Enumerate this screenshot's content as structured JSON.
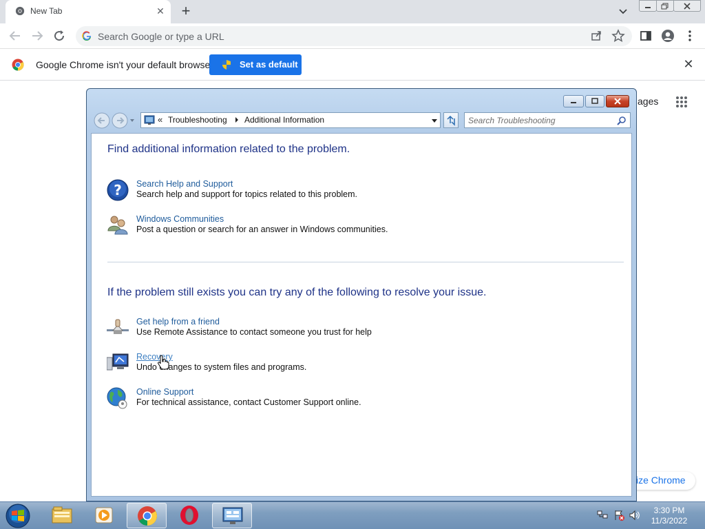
{
  "browser": {
    "tab": {
      "title": "New Tab",
      "close": "✕"
    },
    "new_tab_label": "+",
    "omnibox": {
      "placeholder": "Search Google or type a URL"
    },
    "infobar": {
      "message": "Google Chrome isn't your default browser",
      "button": "Set as default",
      "close": "✕"
    },
    "ntp": {
      "images_link_partial": "ages",
      "customize_partial": "ize Chrome"
    }
  },
  "explorer": {
    "breadcrumb": {
      "chev": "«",
      "items": [
        "Troubleshooting",
        "Additional Information"
      ]
    },
    "search": {
      "placeholder": "Search Troubleshooting"
    },
    "sections": [
      {
        "heading": "Find additional information related to the problem.",
        "items": [
          {
            "icon": "help-icon",
            "title": "Search Help and Support",
            "desc": "Search help and support for topics related to this problem."
          },
          {
            "icon": "people-icon",
            "title": "Windows Communities",
            "desc": "Post a question or search for an answer in Windows communities."
          }
        ]
      },
      {
        "heading": "If the problem still exists you can try any of the following to resolve your issue.",
        "items": [
          {
            "icon": "remote-assistance-icon",
            "title": "Get help from a friend",
            "desc": "Use Remote Assistance to contact someone you trust for help"
          },
          {
            "icon": "recovery-icon",
            "title": "Recovery",
            "desc": "Undo changes to system files and programs."
          },
          {
            "icon": "globe-icon",
            "title": "Online Support",
            "desc": "For technical assistance, contact Customer Support online."
          }
        ]
      }
    ]
  },
  "taskbar": {
    "apps": [
      "windows-explorer-icon",
      "media-player-icon",
      "chrome-icon",
      "opera-icon",
      "control-panel-icon"
    ],
    "clock": {
      "time": "3:30 PM",
      "date": "11/3/2022"
    }
  },
  "colors": {
    "link": "#1e5b9b",
    "heading": "#1e3287",
    "chrome_blue": "#1a73e8"
  }
}
